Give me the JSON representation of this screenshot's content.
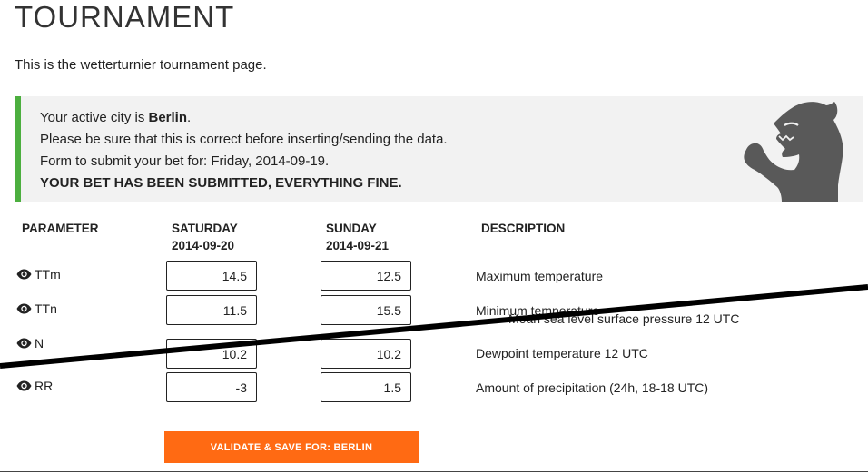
{
  "page": {
    "title": "TOURNAMENT",
    "intro": "This is the wetterturnier tournament page."
  },
  "alert": {
    "active_city_prefix": "Your active city is ",
    "active_city": "Berlin",
    "active_city_suffix": ".",
    "check_notice": "Please be sure that this is correct before inserting/sending the data.",
    "form_for": "Form to submit your bet for: Friday, 2014-09-19.",
    "status": "YOUR BET HAS BEEN SUBMITTED, EVERYTHING FINE.",
    "accent_color": "#4caf3f"
  },
  "table": {
    "headers": {
      "parameter": "PARAMETER",
      "day1_name": "SATURDAY",
      "day1_date": "2014-09-20",
      "day2_name": "SUNDAY",
      "day2_date": "2014-09-21",
      "description": "DESCRIPTION"
    },
    "rows": [
      {
        "param": "TTm",
        "icon": "eye-icon",
        "day1": "14.5",
        "day2": "12.5",
        "description": "Maximum temperature"
      },
      {
        "param": "TTn",
        "icon": "eye-icon",
        "day1": "11.5",
        "day2": "15.5",
        "description": "Minimum temperature"
      },
      {
        "param": "N",
        "icon": "eye-icon",
        "day1": "10.2",
        "day2": "10.2",
        "description": "Dewpoint temperature 12 UTC"
      },
      {
        "param": "RR",
        "icon": "eye-icon",
        "day1": "-3",
        "day2": "1.5",
        "description": "Amount of precipitation (24h, 18-18 UTC)"
      }
    ],
    "overlapping_description": "Mean sea level surface pressure 12 UTC"
  },
  "submit": {
    "label": "VALIDATE & SAVE    FOR: BERLIN",
    "color": "#ff6a13"
  }
}
